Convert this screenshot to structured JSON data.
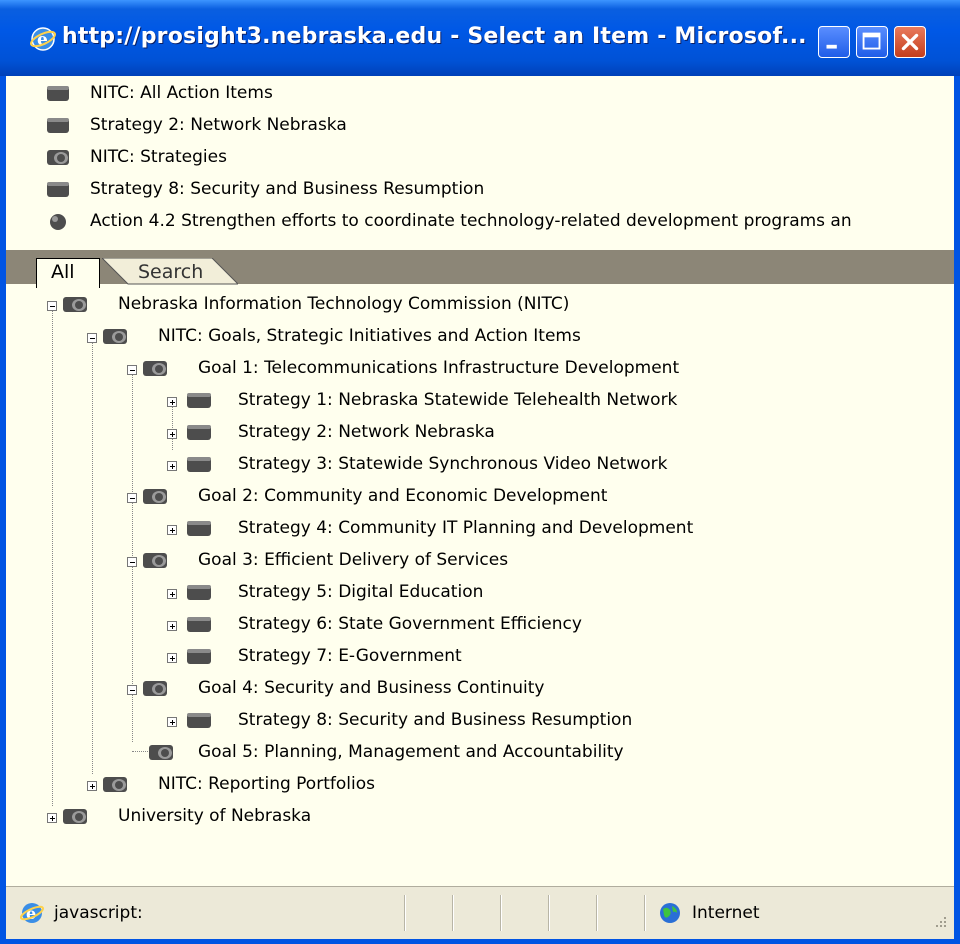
{
  "window": {
    "title": "http://prosight3.nebraska.edu - Select an Item - Microsof..."
  },
  "breadcrumbs": [
    {
      "icon": "folder-closed-icon",
      "label": "NITC: All Action Items"
    },
    {
      "icon": "folder-closed-icon",
      "label": "Strategy 2: Network Nebraska"
    },
    {
      "icon": "folder-open-icon",
      "label": "NITC: Strategies"
    },
    {
      "icon": "folder-closed-icon",
      "label": "Strategy 8: Security and Business Resumption"
    },
    {
      "icon": "item-ball-icon",
      "label": "Action 4.2 Strengthen efforts to coordinate technology-related development programs an"
    }
  ],
  "tabs": {
    "all": "All",
    "search": "Search"
  },
  "tree": [
    {
      "label": "Nebraska Information Technology Commission (NITC)",
      "level": 0,
      "state": "expanded",
      "icon": "folder-open-icon"
    },
    {
      "label": "NITC: Goals, Strategic Initiatives and Action Items",
      "level": 1,
      "state": "expanded",
      "icon": "folder-open-icon"
    },
    {
      "label": "Goal 1: Telecommunications Infrastructure Development",
      "level": 2,
      "state": "expanded",
      "icon": "folder-open-icon"
    },
    {
      "label": "Strategy 1: Nebraska Statewide Telehealth Network",
      "level": 3,
      "state": "collapsed",
      "icon": "folder-closed-icon"
    },
    {
      "label": "Strategy 2: Network Nebraska",
      "level": 3,
      "state": "collapsed",
      "icon": "folder-closed-icon"
    },
    {
      "label": "Strategy 3: Statewide Synchronous Video Network",
      "level": 3,
      "state": "collapsed",
      "icon": "folder-closed-icon"
    },
    {
      "label": "Goal 2: Community and Economic Development",
      "level": 2,
      "state": "expanded",
      "icon": "folder-open-icon"
    },
    {
      "label": "Strategy 4: Community IT Planning and Development",
      "level": 3,
      "state": "collapsed",
      "icon": "folder-closed-icon"
    },
    {
      "label": "Goal 3: Efficient Delivery of Services",
      "level": 2,
      "state": "expanded",
      "icon": "folder-open-icon"
    },
    {
      "label": "Strategy 5: Digital Education",
      "level": 3,
      "state": "collapsed",
      "icon": "folder-closed-icon"
    },
    {
      "label": "Strategy 6: State Government Efficiency",
      "level": 3,
      "state": "collapsed",
      "icon": "folder-closed-icon"
    },
    {
      "label": "Strategy 7: E-Government",
      "level": 3,
      "state": "collapsed",
      "icon": "folder-closed-icon"
    },
    {
      "label": "Goal 4: Security and Business Continuity",
      "level": 2,
      "state": "expanded",
      "icon": "folder-open-icon"
    },
    {
      "label": "Strategy 8: Security and Business Resumption",
      "level": 3,
      "state": "collapsed",
      "icon": "folder-closed-icon"
    },
    {
      "label": "Goal 5: Planning, Management and Accountability",
      "level": 2,
      "state": "leaf",
      "icon": "folder-open-icon"
    },
    {
      "label": "NITC: Reporting Portfolios",
      "level": 1,
      "state": "collapsed",
      "icon": "folder-open-icon"
    },
    {
      "label": "University of Nebraska",
      "level": 0,
      "state": "collapsed",
      "icon": "folder-open-icon"
    }
  ],
  "status": {
    "text": "javascript:",
    "zone": "Internet"
  }
}
